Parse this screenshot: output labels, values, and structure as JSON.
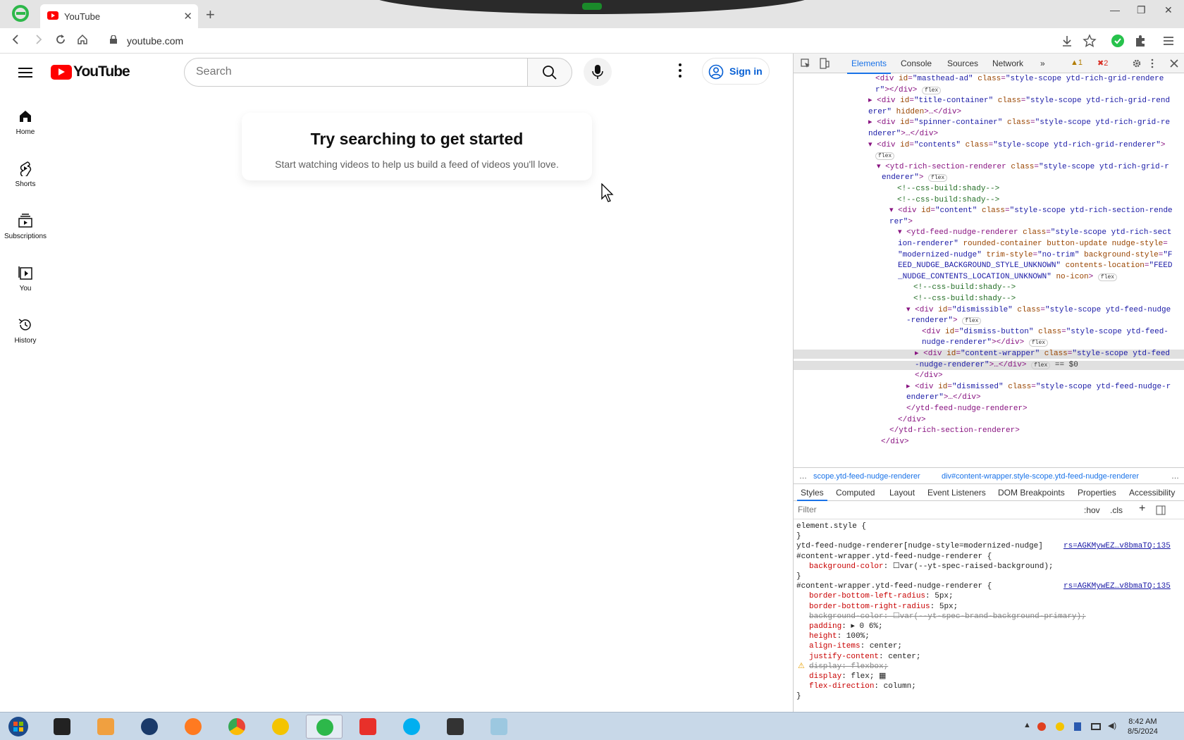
{
  "browser": {
    "tab_title": "YouTube",
    "tab_close": "✕",
    "new_tab": "+",
    "url": "youtube.com",
    "win_min": "—",
    "win_max": "❐",
    "win_close": "✕"
  },
  "youtube": {
    "wordmark": "YouTube",
    "search_placeholder": "Search",
    "signin_label": "Sign in",
    "nav": [
      {
        "label": "Home"
      },
      {
        "label": "Shorts"
      },
      {
        "label": "Subscriptions"
      },
      {
        "label": "You"
      },
      {
        "label": "History"
      }
    ],
    "nudge_title": "Try searching to get started",
    "nudge_body": "Start watching videos to help us build a feed of videos you'll love."
  },
  "devtools": {
    "tabs": [
      "Elements",
      "Console",
      "Sources",
      "Network",
      "»"
    ],
    "warnings": "1",
    "errors": "2",
    "dom_lines": [
      {
        "indent": 116,
        "html": "<span class='tag'>&lt;div</span> <span class='an'>id</span>=<span class='av'>\"masthead-ad\"</span> <span class='an'>class</span>=<span class='av'>\"style-scope ytd-rich-grid-rendere</span>"
      },
      {
        "indent": 116,
        "html": "<span class='av'>r\"</span><span class='tag'>&gt;&lt;/div&gt;</span> <span class='pill'>flex</span>"
      },
      {
        "indent": 106,
        "html": "▸ <span class='tag'>&lt;div</span> <span class='an'>id</span>=<span class='av'>\"title-container\"</span> <span class='an'>class</span>=<span class='av'>\"style-scope ytd-rich-grid-rend</span>"
      },
      {
        "indent": 106,
        "html": "<span class='av'>erer\"</span> <span class='an'>hidden</span><span class='tag'>&gt;</span>…<span class='tag'>&lt;/div&gt;</span>"
      },
      {
        "indent": 106,
        "html": "▸ <span class='tag'>&lt;div</span> <span class='an'>id</span>=<span class='av'>\"spinner-container\"</span> <span class='an'>class</span>=<span class='av'>\"style-scope ytd-rich-grid-re</span>"
      },
      {
        "indent": 106,
        "html": "<span class='av'>nderer\"</span><span class='tag'>&gt;</span>…<span class='tag'>&lt;/div&gt;</span>"
      },
      {
        "indent": 106,
        "html": "▾ <span class='tag'>&lt;div</span> <span class='an'>id</span>=<span class='av'>\"contents\"</span> <span class='an'>class</span>=<span class='av'>\"style-scope ytd-rich-grid-renderer\"</span><span class='tag'>&gt;</span>"
      },
      {
        "indent": 116,
        "html": "<span class='pill'>flex</span>"
      },
      {
        "indent": 118,
        "html": "▾ <span class='tag'>&lt;ytd-rich-section-renderer</span> <span class='an'>class</span>=<span class='av'>\"style-scope ytd-rich-grid-r</span>"
      },
      {
        "indent": 125,
        "html": "<span class='av'>enderer\"</span><span class='tag'>&gt;</span> <span class='pill'>flex</span>"
      },
      {
        "indent": 147,
        "html": "<span class='cm'>&lt;!--css-build:shady--&gt;</span>"
      },
      {
        "indent": 147,
        "html": "<span class='cm'>&lt;!--css-build:shady--&gt;</span>"
      },
      {
        "indent": 136,
        "html": "▾ <span class='tag'>&lt;div</span> <span class='an'>id</span>=<span class='av'>\"content\"</span> <span class='an'>class</span>=<span class='av'>\"style-scope ytd-rich-section-rende</span>"
      },
      {
        "indent": 136,
        "html": "<span class='av'>rer\"</span><span class='tag'>&gt;</span>"
      },
      {
        "indent": 148,
        "html": "▾ <span class='tag'>&lt;ytd-feed-nudge-renderer</span> <span class='an'>class</span>=<span class='av'>\"style-scope ytd-rich-sect</span>"
      },
      {
        "indent": 148,
        "html": "<span class='av'>ion-renderer\"</span> <span class='an'>rounded-container button-update nudge-style</span>="
      },
      {
        "indent": 148,
        "html": "<span class='av'>\"modernized-nudge\"</span> <span class='an'>trim-style</span>=<span class='av'>\"no-trim\"</span> <span class='an'>background-style</span>=<span class='av'>\"F</span>"
      },
      {
        "indent": 148,
        "html": "<span class='av'>EED_NUDGE_BACKGROUND_STYLE_UNKNOWN\"</span> <span class='an'>contents-location</span>=<span class='av'>\"FEED</span>"
      },
      {
        "indent": 148,
        "html": "<span class='av'>_NUDGE_CONTENTS_LOCATION_UNKNOWN\"</span> <span class='an'>no-icon</span><span class='tag'>&gt;</span> <span class='pill'>flex</span>"
      },
      {
        "indent": 170,
        "html": "<span class='cm'>&lt;!--css-build:shady--&gt;</span>"
      },
      {
        "indent": 170,
        "html": "<span class='cm'>&lt;!--css-build:shady--&gt;</span>"
      },
      {
        "indent": 160,
        "html": "▾ <span class='tag'>&lt;div</span> <span class='an'>id</span>=<span class='av'>\"dismissible\"</span> <span class='an'>class</span>=<span class='av'>\"style-scope ytd-feed-nudge</span>"
      },
      {
        "indent": 160,
        "html": "<span class='av'>-renderer\"</span><span class='tag'>&gt;</span> <span class='pill'>flex</span>"
      },
      {
        "indent": 182,
        "html": "<span class='tag'>&lt;div</span> <span class='an'>id</span>=<span class='av'>\"dismiss-button\"</span> <span class='an'>class</span>=<span class='av'>\"style-scope ytd-feed-</span>"
      },
      {
        "indent": 182,
        "html": "<span class='av'>nudge-renderer\"</span><span class='tag'>&gt;&lt;/div&gt;</span> <span class='pill'>flex</span>"
      },
      {
        "indent": 172,
        "html": "▸ <span class='tag'>&lt;div</span> <span class='an'>id</span>=<span class='av'>\"content-wrapper\"</span> <span class='an'>class</span>=<span class='av'>\"style-scope ytd-feed</span>",
        "sel": true
      },
      {
        "indent": 172,
        "html": "<span class='av'>-nudge-renderer\"</span><span class='tag'>&gt;</span>…<span class='tag'>&lt;/div&gt;</span> <span class='pill'>flex</span> <span class='tx'>== $0</span>",
        "sel": true
      },
      {
        "indent": 172,
        "html": "<span class='tag'>&lt;/div&gt;</span>"
      },
      {
        "indent": 160,
        "html": "▸ <span class='tag'>&lt;div</span> <span class='an'>id</span>=<span class='av'>\"dismissed\"</span> <span class='an'>class</span>=<span class='av'>\"style-scope ytd-feed-nudge-r</span>"
      },
      {
        "indent": 160,
        "html": "<span class='av'>enderer\"</span><span class='tag'>&gt;</span>…<span class='tag'>&lt;/div&gt;</span>"
      },
      {
        "indent": 160,
        "html": "<span class='tag'>&lt;/ytd-feed-nudge-renderer&gt;</span>"
      },
      {
        "indent": 148,
        "html": "<span class='tag'>&lt;/div&gt;</span>"
      },
      {
        "indent": 136,
        "html": "<span class='tag'>&lt;/ytd-rich-section-renderer&gt;</span>"
      },
      {
        "indent": 124,
        "html": "<span class='tag'>&lt;/div&gt;</span>"
      }
    ],
    "breadcrumb_1": "scope.ytd-feed-nudge-renderer",
    "breadcrumb_2": "div#content-wrapper.style-scope.ytd-feed-nudge-renderer",
    "subtabs": [
      "Styles",
      "Computed",
      "Layout",
      "Event Listeners",
      "DOM Breakpoints",
      "Properties",
      "Accessibility"
    ],
    "filter_placeholder": "Filter",
    "filter_hov": ":hov",
    "filter_cls": ".cls",
    "style_lines": [
      {
        "indent": 4,
        "html": "element.style {"
      },
      {
        "indent": 4,
        "html": "}"
      },
      {
        "indent": 4,
        "html": "ytd-feed-nudge-renderer[nudge-style=modernized-nudge]",
        "link": "rs=AGKMywEZ…v8bmaTQ:135"
      },
      {
        "indent": 4,
        "html": "#content-wrapper.ytd-feed-nudge-renderer {"
      },
      {
        "indent": 22,
        "html": "<span class='prop'>background-color</span>: <span class='val'>☐var(--yt-spec-raised-background);</span>"
      },
      {
        "indent": 4,
        "html": "}"
      },
      {
        "indent": 4,
        "html": "#content-wrapper.ytd-feed-nudge-renderer {",
        "link": "rs=AGKMywEZ…v8bmaTQ:135"
      },
      {
        "indent": 22,
        "html": "<span class='prop'>border-bottom-left-radius</span>: 5px;"
      },
      {
        "indent": 22,
        "html": "<span class='prop'>border-bottom-right-radius</span>: 5px;"
      },
      {
        "indent": 22,
        "html": "<span class='strike'>background-color: ☐var(--yt-spec-brand-background-primary);</span>"
      },
      {
        "indent": 22,
        "html": "<span class='prop'>padding</span>: ▸ 0 6%;"
      },
      {
        "indent": 22,
        "html": "<span class='prop'>height</span>: 100%;"
      },
      {
        "indent": 22,
        "html": "<span class='prop'>align-items</span>: center;"
      },
      {
        "indent": 22,
        "html": "<span class='prop'>justify-content</span>: center;"
      },
      {
        "indent": 22,
        "html": "<span class='strike'>display: flexbox;</span>",
        "warn": true
      },
      {
        "indent": 22,
        "html": "<span class='prop'>display</span>: flex; ▦"
      },
      {
        "indent": 22,
        "html": "<span class='prop'>flex-direction</span>: column;"
      },
      {
        "indent": 4,
        "html": "}"
      }
    ]
  },
  "taskbar": {
    "time": "8:42 AM",
    "date": "8/5/2024"
  },
  "colors": {
    "yt_red": "#ff0000",
    "signin_blue": "#065fd4",
    "devtools_accent": "#1a73e8"
  }
}
